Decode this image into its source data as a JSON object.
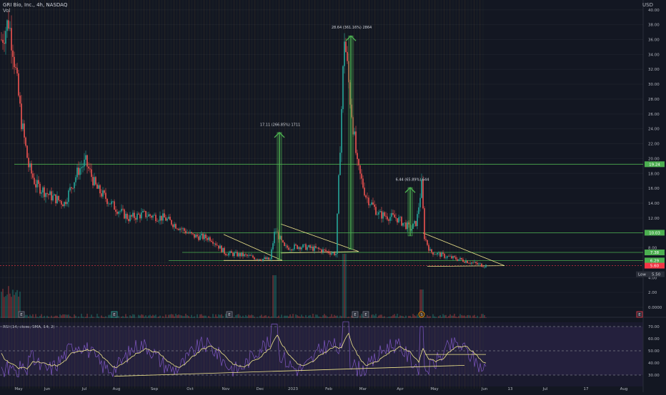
{
  "header": {
    "symbol_line": "GRI Bio, Inc., 4h, NASDAQ",
    "sub_line": "Vol",
    "currency": "USD"
  },
  "rsi_label": "RSI (14, close, SMA, 14, 2)",
  "price_axis": {
    "ticks": [
      0,
      2,
      4,
      6,
      8,
      10,
      12,
      14,
      16,
      18,
      20,
      22,
      24,
      26,
      28,
      30,
      32,
      34,
      36,
      38,
      40
    ],
    "labels": [
      "0.0000",
      "2.00",
      "4.00",
      "6.00",
      "8.00",
      "10.00",
      "12.00",
      "14.00",
      "16.00",
      "18.00",
      "20.00",
      "22.00",
      "24.00",
      "26.00",
      "28.00",
      "30.00",
      "32.00",
      "34.00",
      "36.00",
      "38.00",
      "40.00"
    ]
  },
  "rsi_axis": {
    "ticks": [
      30,
      40,
      50,
      60,
      70
    ],
    "labels": [
      "30.00",
      "40.00",
      "50.00",
      "60.00",
      "70.00"
    ]
  },
  "time_axis": [
    "May",
    "Jun",
    "Jul",
    "Aug",
    "Sep",
    "Oct",
    "Nov",
    "Dec",
    "2023",
    "Feb",
    "Mar",
    "Apr",
    "May",
    "Jun",
    "13",
    "Jul",
    "17",
    "Aug"
  ],
  "price_tags": [
    {
      "text": "19.24",
      "value": 19.24,
      "color": "#4caf50"
    },
    {
      "text": "10.03",
      "value": 10.03,
      "color": "#4caf50"
    },
    {
      "text": "7.38",
      "value": 7.38,
      "color": "#4caf50"
    },
    {
      "text": "6.29",
      "value": 6.29,
      "color": "#4caf50"
    },
    {
      "text": "5.60",
      "value": 5.6,
      "color": "#f23645"
    }
  ],
  "low_tag": {
    "label": "Low",
    "value": "5.50"
  },
  "annotations": [
    {
      "text": "17.11 (266.85%) 1711"
    },
    {
      "text": "28.64 (361.16%) 2864"
    },
    {
      "text": "6.44 (65.89%) 644"
    }
  ],
  "event_markers": [
    "E",
    "E",
    "E",
    "E",
    "E",
    "S",
    "E"
  ],
  "chart_data": {
    "type": "candlestick",
    "title": "GRI Bio, Inc., 4h, NASDAQ",
    "y_axis": {
      "currency": "USD",
      "range": [
        0,
        40
      ]
    },
    "x_axis_labels": [
      "May",
      "Jun",
      "Jul",
      "Aug",
      "Sep",
      "Oct",
      "Nov",
      "Dec",
      "2023",
      "Feb",
      "Mar",
      "Apr",
      "May",
      "Jun",
      "13",
      "Jul",
      "17",
      "Aug"
    ],
    "close_path": [
      {
        "x": "May",
        "close": 36.0
      },
      {
        "x": "May",
        "close": 38.5
      },
      {
        "x": "May",
        "close": 35.0
      },
      {
        "x": "May",
        "close": 25.0
      },
      {
        "x": "May",
        "close": 19.0
      },
      {
        "x": "Jun",
        "close": 16.5
      },
      {
        "x": "Jun",
        "close": 15.0
      },
      {
        "x": "Jun",
        "close": 14.0
      },
      {
        "x": "Jul",
        "close": 18.5
      },
      {
        "x": "Jul",
        "close": 19.5
      },
      {
        "x": "Jul",
        "close": 16.0
      },
      {
        "x": "Aug",
        "close": 13.5
      },
      {
        "x": "Aug",
        "close": 12.0
      },
      {
        "x": "Aug",
        "close": 12.5
      },
      {
        "x": "Sep",
        "close": 12.0
      },
      {
        "x": "Sep",
        "close": 10.5
      },
      {
        "x": "Oct",
        "close": 9.6
      },
      {
        "x": "Oct",
        "close": 9.3
      },
      {
        "x": "Nov",
        "close": 7.3
      },
      {
        "x": "Nov",
        "close": 7.0
      },
      {
        "x": "Dec",
        "close": 6.6
      },
      {
        "x": "Dec",
        "close": 6.4
      },
      {
        "x": "Dec",
        "close": 10.5
      },
      {
        "x": "Dec",
        "close": 8.0
      },
      {
        "x": "2023",
        "close": 8.2
      },
      {
        "x": "2023",
        "close": 7.8
      },
      {
        "x": "Feb",
        "close": 7.2
      },
      {
        "x": "Feb",
        "close": 36.5
      },
      {
        "x": "Feb",
        "close": 28.0
      },
      {
        "x": "Feb",
        "close": 19.0
      },
      {
        "x": "Mar",
        "close": 15.0
      },
      {
        "x": "Mar",
        "close": 12.5
      },
      {
        "x": "Mar",
        "close": 12.0
      },
      {
        "x": "Apr",
        "close": 10.5
      },
      {
        "x": "Apr",
        "close": 11.5
      },
      {
        "x": "Apr",
        "close": 16.5
      },
      {
        "x": "Apr",
        "close": 9.5
      },
      {
        "x": "Apr",
        "close": 7.5
      },
      {
        "x": "May",
        "close": 6.8
      },
      {
        "x": "May",
        "close": 6.3
      },
      {
        "x": "May",
        "close": 5.8
      },
      {
        "x": "Jun",
        "close": 5.6
      }
    ],
    "horizontal_levels": [
      19.24,
      10.03,
      7.38,
      6.29
    ],
    "rsi": {
      "overbought": 70,
      "mid": 50,
      "oversold": 30,
      "last_sma": 47
    }
  }
}
